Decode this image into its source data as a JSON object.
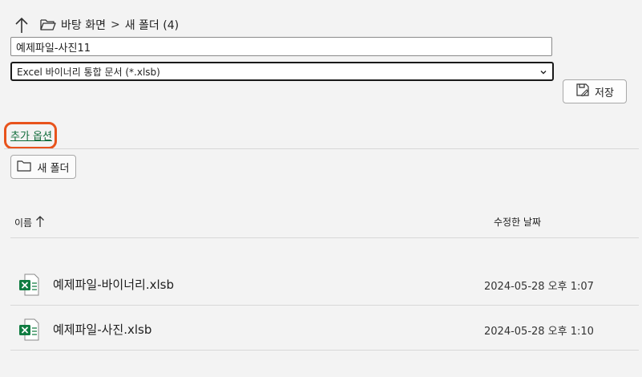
{
  "breadcrumb": {
    "items": [
      "바탕 화면",
      "새 폴더 (4)"
    ],
    "separator": ">"
  },
  "filename": {
    "value": "예제파일-사진11"
  },
  "filetype": {
    "selected": "Excel 바이너리 통합 문서 (*.xlsb)"
  },
  "save_button": {
    "label": "저장"
  },
  "more_options": {
    "label": "추가 옵션"
  },
  "new_folder_button": {
    "label": "새 폴더"
  },
  "columns": {
    "name": "이름",
    "date": "수정한 날짜"
  },
  "files": [
    {
      "name": "예제파일-바이너리.xlsb",
      "date": "2024-05-28 오후 1:07",
      "icon": "excel-file-icon"
    },
    {
      "name": "예제파일-사진.xlsb",
      "date": "2024-05-28 오후 1:10",
      "icon": "excel-file-icon"
    }
  ],
  "colors": {
    "accent_green": "#0f6b3a",
    "highlight_orange": "#e8531c",
    "excel_green": "#107c41"
  }
}
